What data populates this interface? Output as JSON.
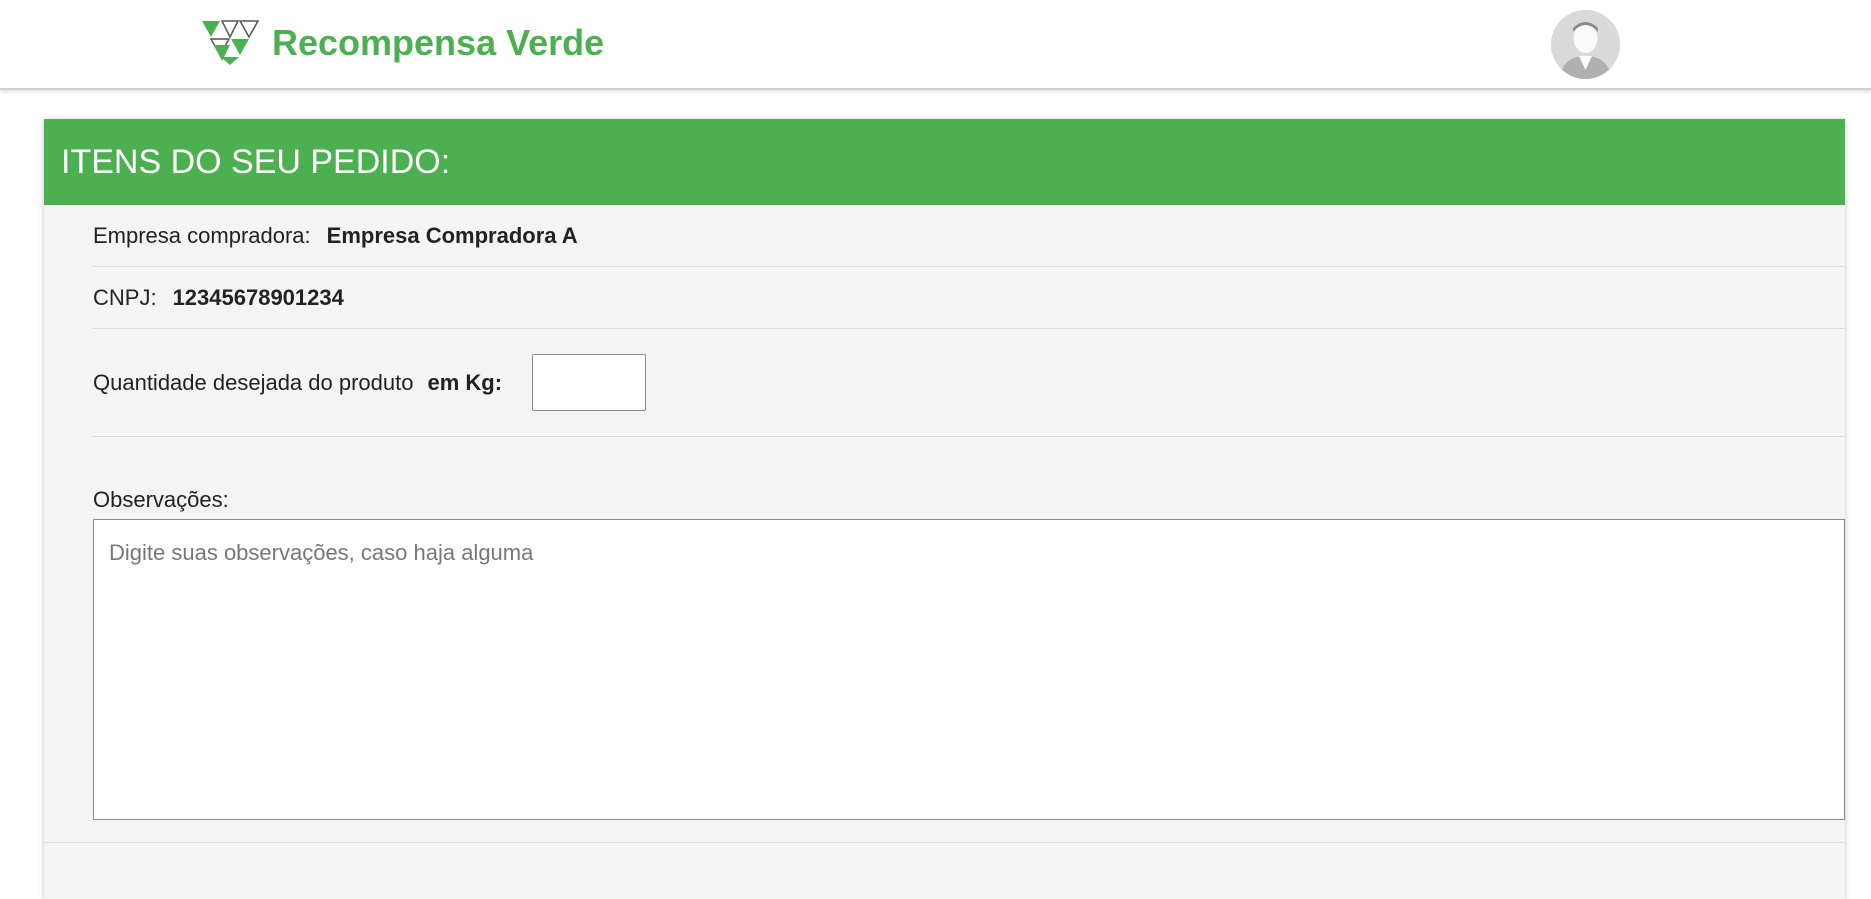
{
  "header": {
    "brand_name": "Recompensa Verde",
    "logo_icon": "triangles-logo-icon",
    "avatar_icon": "user-avatar-icon",
    "brand_color": "#4caf50"
  },
  "order": {
    "title": "ITENS DO SEU PEDIDO:",
    "empresa_label": "Empresa compradora:",
    "empresa_value": "Empresa Compradora A",
    "cnpj_label": "CNPJ:",
    "cnpj_value": "12345678901234",
    "quantidade_label": "Quantidade desejada do produto",
    "quantidade_unit": "em Kg:",
    "quantidade_value": "",
    "observacoes_label": "Observações:",
    "observacoes_placeholder": "Digite suas observações, caso haja alguma",
    "observacoes_value": ""
  }
}
